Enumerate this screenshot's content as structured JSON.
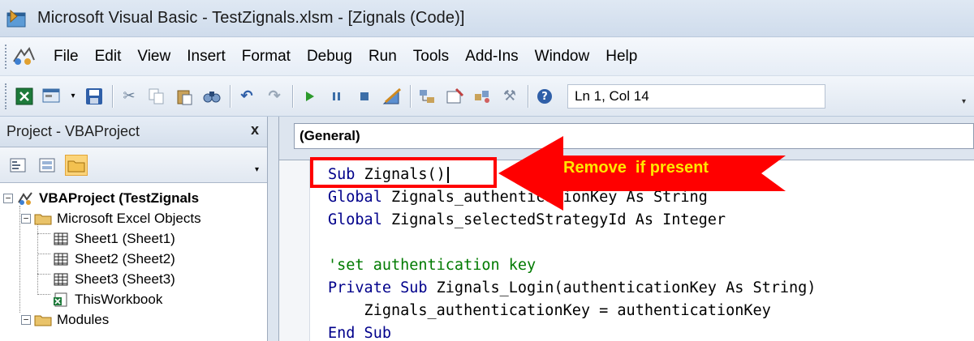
{
  "window": {
    "title": "Microsoft Visual Basic - TestZignals.xlsm - [Zignals (Code)]"
  },
  "menu": [
    "File",
    "Edit",
    "View",
    "Insert",
    "Format",
    "Debug",
    "Run",
    "Tools",
    "Add-Ins",
    "Window",
    "Help"
  ],
  "toolbar": {
    "status": "Ln 1, Col 14"
  },
  "project": {
    "title": "Project - VBAProject",
    "close": "x",
    "tree": {
      "root": "VBAProject (TestZignals",
      "excel_objects": "Microsoft Excel Objects",
      "sheets": [
        "Sheet1 (Sheet1)",
        "Sheet2 (Sheet2)",
        "Sheet3 (Sheet3)"
      ],
      "workbook": "ThisWorkbook",
      "modules": "Modules"
    }
  },
  "code_window": {
    "object_combo": "(General)",
    "lines": [
      {
        "kw": "Sub ",
        "rest": "Zignals()"
      },
      {
        "kw": "Global ",
        "rest": "Zignals_authenticationKey As String"
      },
      {
        "kw": "Global ",
        "rest": "Zignals_selectedStrategyId As Integer"
      },
      {
        "kw": "",
        "rest": ""
      },
      {
        "comment": "'set authentication key"
      },
      {
        "kw": "Private Sub ",
        "rest": "Zignals_Login(authenticationKey As String)"
      },
      {
        "kw": "",
        "rest": "    Zignals_authenticationKey = authenticationKey"
      },
      {
        "kw": "End Sub",
        "rest": ""
      }
    ]
  },
  "annotation": {
    "text": "Remove  if present",
    "color": "#ff0000",
    "text_color": "#ffe600"
  },
  "colors": {
    "keyword": "#00008b",
    "comment": "#007a00"
  }
}
